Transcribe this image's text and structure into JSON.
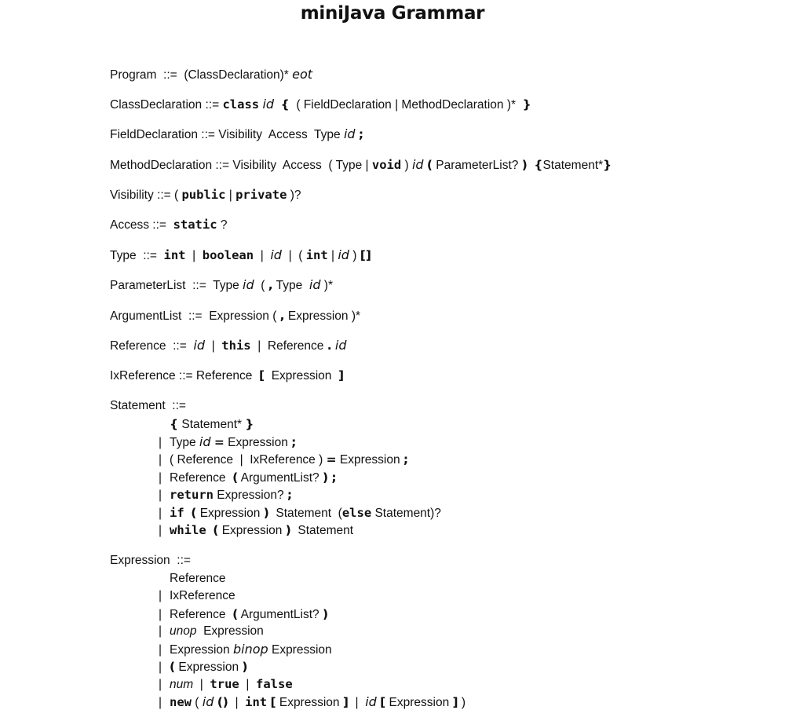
{
  "title": "miniJava Grammar",
  "rules": [
    {
      "name": "Program",
      "tokens": [
        {
          "t": "nt",
          "v": "Program"
        },
        {
          "t": "op",
          "v": "  ::=  "
        },
        {
          "t": "nt",
          "v": "(ClassDeclaration)* "
        },
        {
          "t": "it",
          "v": "eot"
        }
      ]
    },
    {
      "name": "ClassDeclaration",
      "tokens": [
        {
          "t": "nt",
          "v": "ClassDeclaration"
        },
        {
          "t": "op",
          "v": " ::= "
        },
        {
          "t": "kw",
          "v": "class"
        },
        {
          "t": "op",
          "v": " "
        },
        {
          "t": "it",
          "v": "id"
        },
        {
          "t": "op",
          "v": "  "
        },
        {
          "t": "p",
          "v": "{"
        },
        {
          "t": "nt",
          "v": "  ( FieldDeclaration | MethodDeclaration )*  "
        },
        {
          "t": "p",
          "v": "}"
        }
      ]
    },
    {
      "name": "FieldDeclaration",
      "tokens": [
        {
          "t": "nt",
          "v": "FieldDeclaration"
        },
        {
          "t": "op",
          "v": " ::= "
        },
        {
          "t": "nt",
          "v": "Visibility  Access  Type "
        },
        {
          "t": "it",
          "v": "id"
        },
        {
          "t": "op",
          "v": " "
        },
        {
          "t": "p",
          "v": ";"
        }
      ]
    },
    {
      "name": "MethodDeclaration",
      "tokens": [
        {
          "t": "nt",
          "v": "MethodDeclaration"
        },
        {
          "t": "op",
          "v": " ::= "
        },
        {
          "t": "nt",
          "v": "Visibility  Access  ( Type | "
        },
        {
          "t": "kw",
          "v": "void"
        },
        {
          "t": "nt",
          "v": " ) "
        },
        {
          "t": "it",
          "v": "id"
        },
        {
          "t": "op",
          "v": " "
        },
        {
          "t": "p",
          "v": "("
        },
        {
          "t": "nt",
          "v": " ParameterList? "
        },
        {
          "t": "p",
          "v": ")"
        },
        {
          "t": "op",
          "v": "  "
        },
        {
          "t": "p",
          "v": "{"
        },
        {
          "t": "nt",
          "v": "Statement*"
        },
        {
          "t": "p",
          "v": "}"
        }
      ]
    },
    {
      "name": "Visibility",
      "tokens": [
        {
          "t": "nt",
          "v": "Visibility"
        },
        {
          "t": "op",
          "v": " ::= ( "
        },
        {
          "t": "kw",
          "v": "public"
        },
        {
          "t": "op",
          "v": " | "
        },
        {
          "t": "kw",
          "v": "private"
        },
        {
          "t": "op",
          "v": " )?"
        }
      ]
    },
    {
      "name": "Access",
      "tokens": [
        {
          "t": "nt",
          "v": "Access"
        },
        {
          "t": "op",
          "v": " ::=  "
        },
        {
          "t": "kw",
          "v": "static"
        },
        {
          "t": "op",
          "v": " ?"
        }
      ]
    },
    {
      "name": "Type",
      "tokens": [
        {
          "t": "nt",
          "v": "Type"
        },
        {
          "t": "op",
          "v": "  ::=  "
        },
        {
          "t": "kw",
          "v": "int"
        },
        {
          "t": "op",
          "v": "  |  "
        },
        {
          "t": "kw",
          "v": "boolean"
        },
        {
          "t": "op",
          "v": "  |  "
        },
        {
          "t": "it",
          "v": "id"
        },
        {
          "t": "op",
          "v": "  |  ( "
        },
        {
          "t": "kw",
          "v": "int"
        },
        {
          "t": "op",
          "v": " | "
        },
        {
          "t": "it",
          "v": "id"
        },
        {
          "t": "op",
          "v": " ) "
        },
        {
          "t": "p",
          "v": "[]"
        }
      ]
    },
    {
      "name": "ParameterList",
      "tokens": [
        {
          "t": "nt",
          "v": "ParameterList"
        },
        {
          "t": "op",
          "v": "  ::=  "
        },
        {
          "t": "nt",
          "v": "Type "
        },
        {
          "t": "it",
          "v": "id"
        },
        {
          "t": "op",
          "v": "  ( "
        },
        {
          "t": "p",
          "v": ","
        },
        {
          "t": "nt",
          "v": " Type  "
        },
        {
          "t": "it",
          "v": "id"
        },
        {
          "t": "op",
          "v": " )*"
        }
      ]
    },
    {
      "name": "ArgumentList",
      "tokens": [
        {
          "t": "nt",
          "v": "ArgumentList"
        },
        {
          "t": "op",
          "v": "  ::=  "
        },
        {
          "t": "nt",
          "v": "Expression ( "
        },
        {
          "t": "p",
          "v": ","
        },
        {
          "t": "nt",
          "v": " Expression )*"
        }
      ]
    },
    {
      "name": "Reference",
      "tokens": [
        {
          "t": "nt",
          "v": "Reference"
        },
        {
          "t": "op",
          "v": "  ::=  "
        },
        {
          "t": "it",
          "v": "id"
        },
        {
          "t": "op",
          "v": "  |  "
        },
        {
          "t": "kw",
          "v": "this"
        },
        {
          "t": "op",
          "v": "  |  "
        },
        {
          "t": "nt",
          "v": "Reference "
        },
        {
          "t": "p",
          "v": "."
        },
        {
          "t": "op",
          "v": " "
        },
        {
          "t": "it",
          "v": "id"
        }
      ]
    },
    {
      "name": "IxReference",
      "tokens": [
        {
          "t": "nt",
          "v": "IxReference"
        },
        {
          "t": "op",
          "v": " ::= "
        },
        {
          "t": "nt",
          "v": "Reference  "
        },
        {
          "t": "p",
          "v": "["
        },
        {
          "t": "nt",
          "v": "  Expression  "
        },
        {
          "t": "p",
          "v": "]"
        }
      ]
    }
  ],
  "statement": {
    "head": [
      {
        "t": "nt",
        "v": "Statement"
      },
      {
        "t": "op",
        "v": "  ::="
      }
    ],
    "alternatives": [
      {
        "bar": false,
        "tokens": [
          {
            "t": "p",
            "v": "{"
          },
          {
            "t": "nt",
            "v": " Statement* "
          },
          {
            "t": "p",
            "v": "}"
          }
        ]
      },
      {
        "bar": true,
        "tokens": [
          {
            "t": "nt",
            "v": "Type "
          },
          {
            "t": "it",
            "v": "id"
          },
          {
            "t": "op",
            "v": " "
          },
          {
            "t": "p",
            "v": "="
          },
          {
            "t": "nt",
            "v": " Expression "
          },
          {
            "t": "p",
            "v": ";"
          }
        ]
      },
      {
        "bar": true,
        "tokens": [
          {
            "t": "nt",
            "v": "( Reference  |  IxReference ) "
          },
          {
            "t": "p",
            "v": "="
          },
          {
            "t": "nt",
            "v": " Expression "
          },
          {
            "t": "p",
            "v": ";"
          }
        ]
      },
      {
        "bar": true,
        "tokens": [
          {
            "t": "nt",
            "v": "Reference  "
          },
          {
            "t": "p",
            "v": "("
          },
          {
            "t": "nt",
            "v": " ArgumentList? "
          },
          {
            "t": "p",
            "v": ")"
          },
          {
            "t": "op",
            "v": " "
          },
          {
            "t": "p",
            "v": ";"
          }
        ]
      },
      {
        "bar": true,
        "tokens": [
          {
            "t": "kw",
            "v": "return"
          },
          {
            "t": "nt",
            "v": " Expression? "
          },
          {
            "t": "p",
            "v": ";"
          }
        ]
      },
      {
        "bar": true,
        "tokens": [
          {
            "t": "kw",
            "v": "if"
          },
          {
            "t": "op",
            "v": "  "
          },
          {
            "t": "p",
            "v": "("
          },
          {
            "t": "nt",
            "v": " Expression "
          },
          {
            "t": "p",
            "v": ")"
          },
          {
            "t": "nt",
            "v": "  Statement  ("
          },
          {
            "t": "kw",
            "v": "else"
          },
          {
            "t": "nt",
            "v": " Statement)?"
          }
        ]
      },
      {
        "bar": true,
        "tokens": [
          {
            "t": "kw",
            "v": "while"
          },
          {
            "t": "op",
            "v": "  "
          },
          {
            "t": "p",
            "v": "("
          },
          {
            "t": "nt",
            "v": " Expression "
          },
          {
            "t": "p",
            "v": ")"
          },
          {
            "t": "nt",
            "v": "  Statement"
          }
        ]
      }
    ]
  },
  "expression": {
    "head": [
      {
        "t": "nt",
        "v": "Expression"
      },
      {
        "t": "op",
        "v": "  ::="
      }
    ],
    "alternatives": [
      {
        "bar": false,
        "tokens": [
          {
            "t": "nt",
            "v": "Reference"
          }
        ]
      },
      {
        "bar": true,
        "tokens": [
          {
            "t": "nt",
            "v": "IxReference"
          }
        ]
      },
      {
        "bar": true,
        "tokens": [
          {
            "t": "nt",
            "v": "Reference  "
          },
          {
            "t": "p",
            "v": "("
          },
          {
            "t": "nt",
            "v": " ArgumentList? "
          },
          {
            "t": "p",
            "v": ")"
          }
        ]
      },
      {
        "bar": true,
        "tokens": [
          {
            "t": "itsans",
            "v": "unop"
          },
          {
            "t": "nt",
            "v": "  Expression"
          }
        ]
      },
      {
        "bar": true,
        "tokens": [
          {
            "t": "nt",
            "v": "Expression "
          },
          {
            "t": "it",
            "v": "binop"
          },
          {
            "t": "nt",
            "v": " Expression"
          }
        ]
      },
      {
        "bar": true,
        "tokens": [
          {
            "t": "p",
            "v": "("
          },
          {
            "t": "nt",
            "v": " Expression "
          },
          {
            "t": "p",
            "v": ")"
          }
        ]
      },
      {
        "bar": true,
        "tokens": [
          {
            "t": "itsans",
            "v": "num"
          },
          {
            "t": "op",
            "v": "  |  "
          },
          {
            "t": "kw",
            "v": "true"
          },
          {
            "t": "op",
            "v": "  |  "
          },
          {
            "t": "kw",
            "v": "false"
          }
        ]
      },
      {
        "bar": true,
        "tokens": [
          {
            "t": "kw",
            "v": "new"
          },
          {
            "t": "op",
            "v": " ( "
          },
          {
            "t": "it",
            "v": "id"
          },
          {
            "t": "op",
            "v": " "
          },
          {
            "t": "p",
            "v": "()"
          },
          {
            "t": "op",
            "v": "  |  "
          },
          {
            "t": "kw",
            "v": "int"
          },
          {
            "t": "op",
            "v": " "
          },
          {
            "t": "p",
            "v": "["
          },
          {
            "t": "nt",
            "v": " Expression "
          },
          {
            "t": "p",
            "v": "]"
          },
          {
            "t": "op",
            "v": "  |  "
          },
          {
            "t": "it",
            "v": "id"
          },
          {
            "t": "op",
            "v": " "
          },
          {
            "t": "p",
            "v": "["
          },
          {
            "t": "nt",
            "v": " Expression "
          },
          {
            "t": "p",
            "v": "]"
          },
          {
            "t": "op",
            "v": " )"
          }
        ]
      }
    ]
  }
}
